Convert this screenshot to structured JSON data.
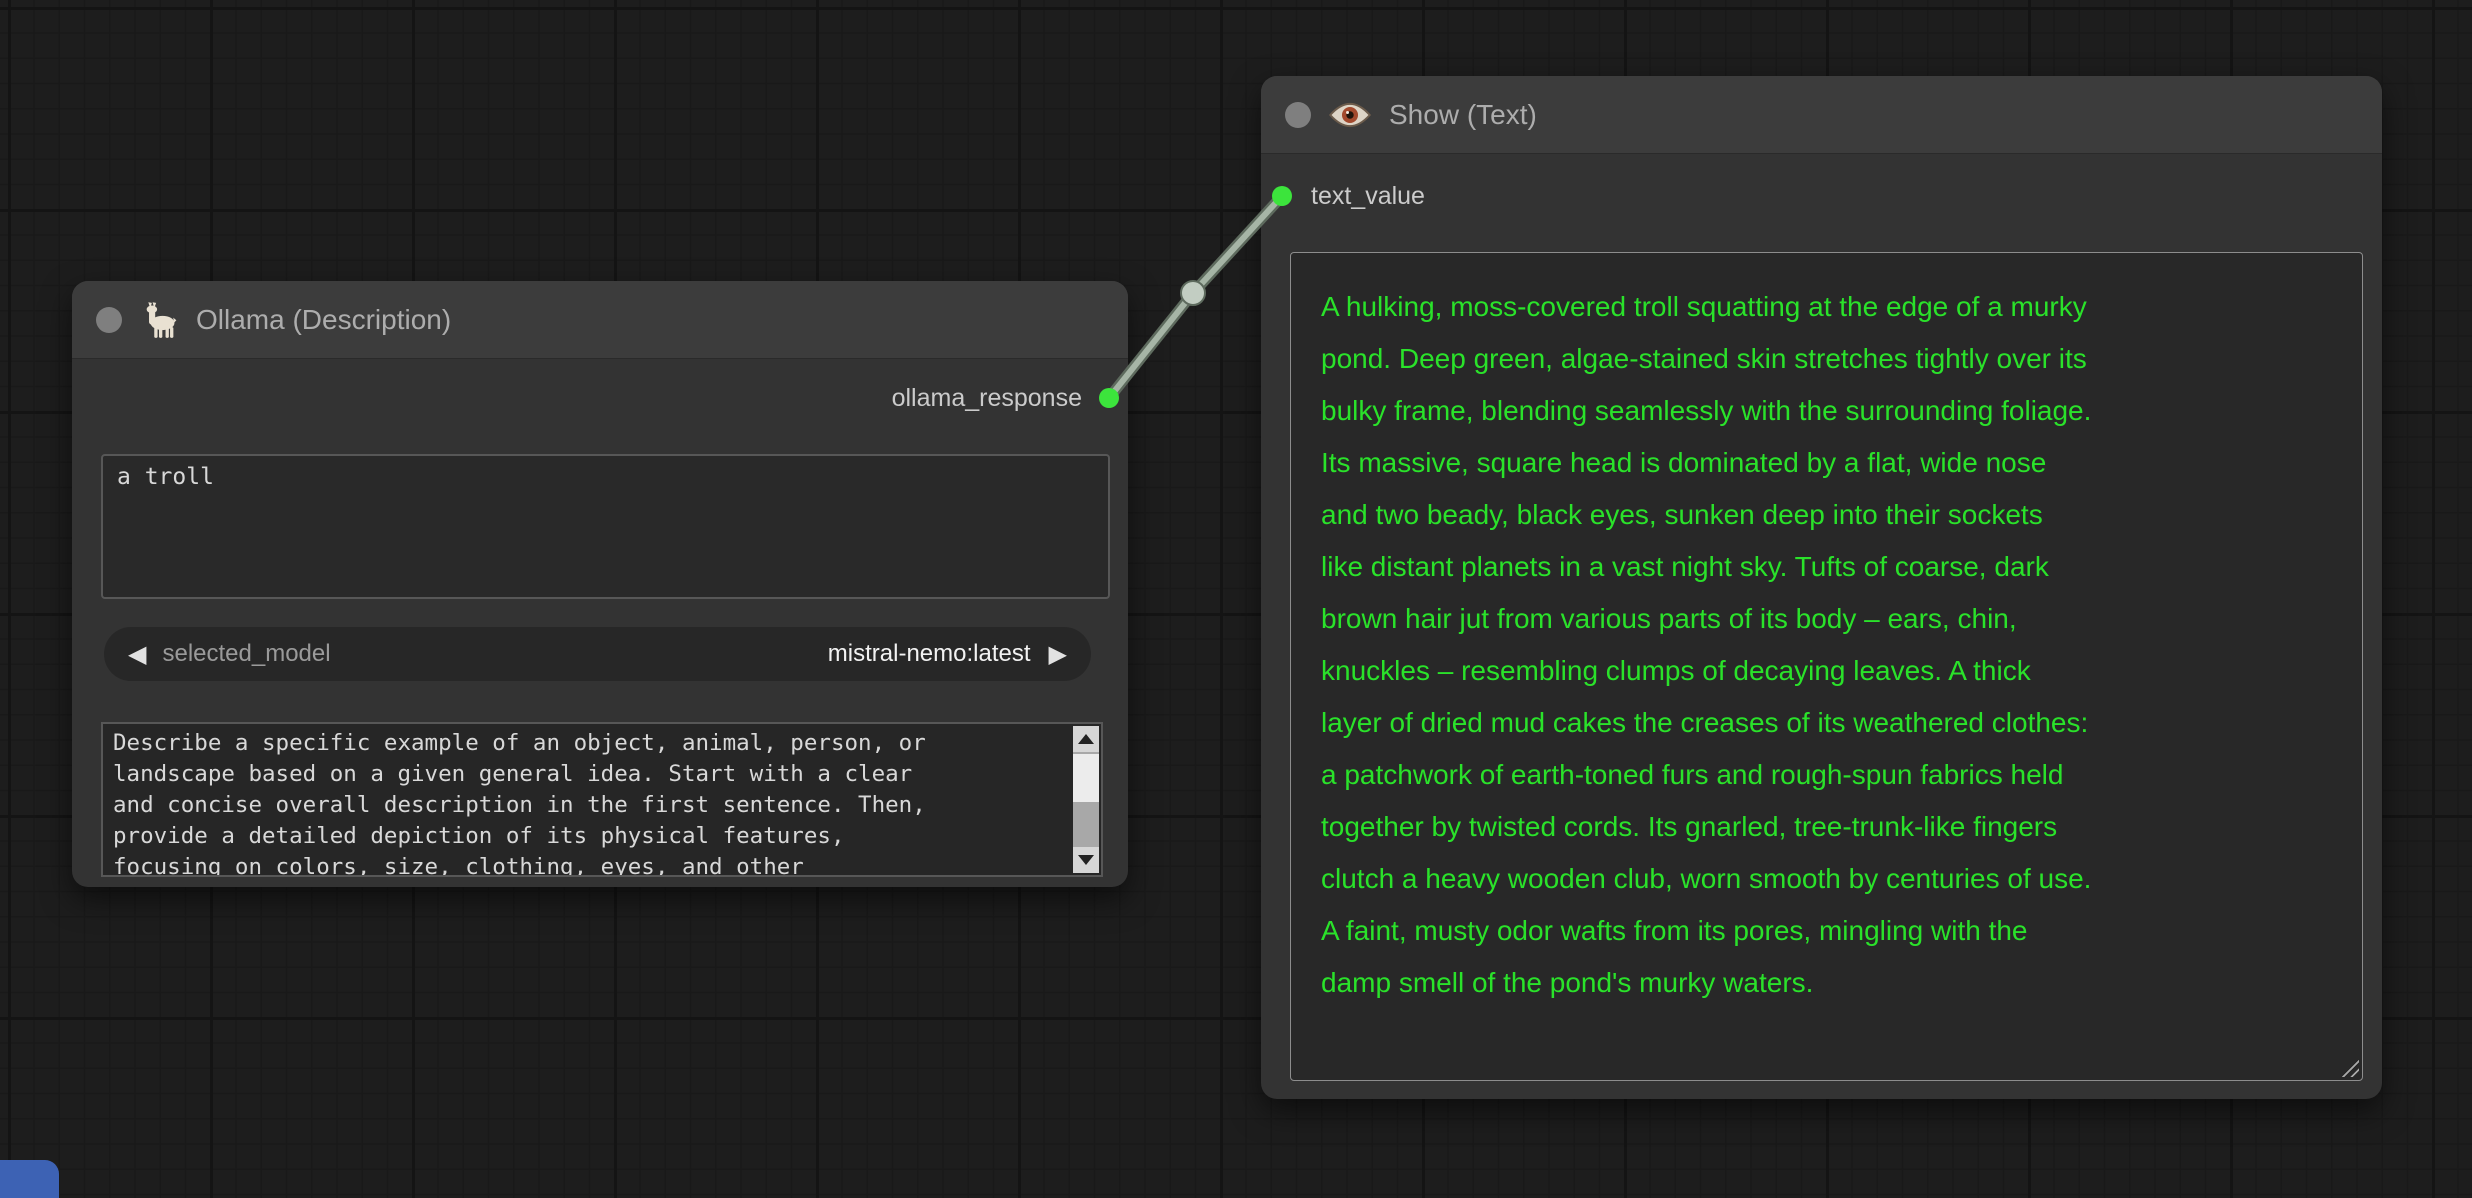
{
  "nodes": {
    "ollama": {
      "title": "Ollama (Description)",
      "icon": "llama-icon",
      "outputs": [
        {
          "name": "ollama_response"
        }
      ],
      "widgets": {
        "prompt_value": "a troll",
        "model_label": "selected_model",
        "model_value": "mistral-nemo:latest",
        "system_prompt": "Describe a specific example of an object, animal, person, or\nlandscape based on a given general idea. Start with a clear\nand concise overall description in the first sentence. Then,\nprovide a detailed depiction of its physical features,\nfocusing on colors, size, clothing, eyes, and other"
      }
    },
    "show": {
      "title": "Show (Text)",
      "icon": "eye-icon",
      "inputs": [
        {
          "name": "text_value"
        }
      ],
      "text_value": "A hulking, moss-covered troll squatting at the edge of a murky\npond. Deep green, algae-stained skin stretches tightly over its\nbulky frame, blending seamlessly with the surrounding foliage.\nIts massive, square head is dominated by a flat, wide nose\nand two beady, black eyes, sunken deep into their sockets\nlike distant planets in a vast night sky. Tufts of coarse, dark\nbrown hair jut from various parts of its body – ears, chin,\nknuckles – resembling clumps of decaying leaves. A thick\nlayer of dried mud cakes the creases of its weathered clothes:\na patchwork of earth-toned furs and rough-spun fabrics held\ntogether by twisted cords. Its gnarled, tree-trunk-like fingers\nclutch a heavy wooden club, worn smooth by centuries of use.\nA faint, musty odor wafts from its pores, mingling with the\ndamp smell of the pond's murky waters."
    }
  },
  "link": {
    "from": "ollama_response",
    "to": "text_value"
  },
  "ui": {
    "prev_arrow": "◀",
    "next_arrow": "▶"
  },
  "colors": {
    "background": "#1d1d1d",
    "node_body": "#333333",
    "node_header": "#3c3c3c",
    "slot_green": "#3ce43c",
    "link": "#a6b5a6",
    "show_text_green": "#2ae22a",
    "partial_node_blue": "#3d62b4"
  }
}
